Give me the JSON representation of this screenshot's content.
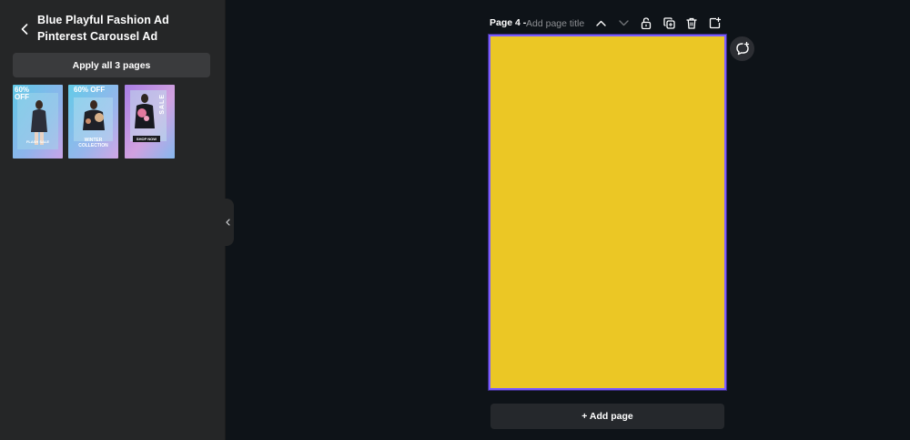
{
  "panel": {
    "template_title": "Blue Playful Fashion Ad Pinterest Carousel Ad",
    "apply_label": "Apply all 3 pages",
    "thumbnails": [
      {
        "headline": "60% OFF",
        "caption": "FLASH SALE"
      },
      {
        "headline": "60% OFF",
        "caption": "WINTER COLLECTION"
      },
      {
        "headline": "SALE",
        "caption": "SHOP NOW"
      }
    ]
  },
  "toolbar": {
    "page_label": "Page 4",
    "separator": " -",
    "title_placeholder": "Add page title"
  },
  "canvas": {
    "page_color": "#ebc725",
    "selection_color": "#7a5cff"
  },
  "add_page_label": "+ Add page",
  "icons": {
    "back": "chevron-left-icon",
    "collapse": "chevron-left-icon",
    "move_up": "chevron-up-icon",
    "move_down": "chevron-down-icon",
    "lock": "lock-icon",
    "duplicate": "duplicate-icon",
    "delete": "trash-icon",
    "add": "add-page-icon",
    "comment": "comment-add-icon"
  }
}
